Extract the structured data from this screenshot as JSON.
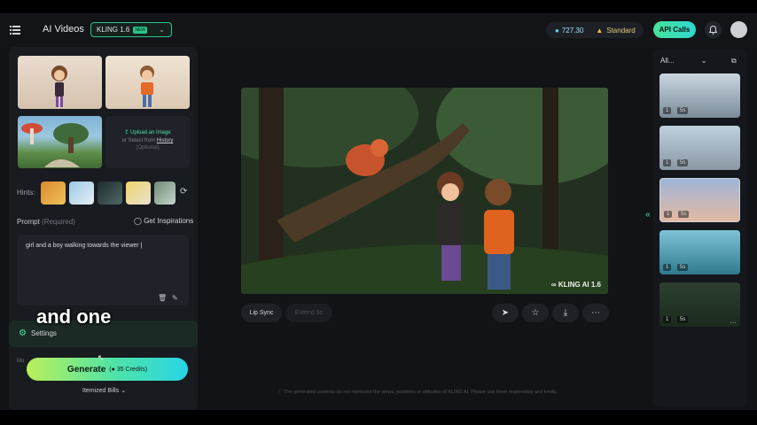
{
  "header": {
    "title": "AI Videos",
    "model": "KLING 1.6",
    "model_badge": "NEW",
    "credits": "727.30",
    "plan": "Standard",
    "api_label": "API Calls"
  },
  "left": {
    "upload_label": "Upload an Image",
    "upload_or": "or Select from",
    "upload_history": "History",
    "upload_optional": "(Optional)",
    "hints_label": "Hints:",
    "prompt_label": "Prompt",
    "prompt_required": "(Required)",
    "inspirations_label": "Get Inspirations",
    "prompt_value": "girl and a boy walking towards the viewer |",
    "settings_label": "Settings",
    "mode_fragment": "Mo",
    "generate_label": "Generate",
    "generate_credits": "35 Credits",
    "itemized_label": "Itemized Bills"
  },
  "caption": "and one",
  "player": {
    "watermark": "KLING AI 1.6",
    "lip_sync": "Lip Sync",
    "extend": "Extend 5s"
  },
  "right": {
    "filter": "All...",
    "items": [
      {
        "count": "1",
        "duration": "5s"
      },
      {
        "count": "1",
        "duration": "5s"
      },
      {
        "count": "1",
        "duration": "5s"
      },
      {
        "count": "1",
        "duration": "5s"
      },
      {
        "count": "1",
        "duration": "5s"
      }
    ]
  },
  "footer": {
    "disclaimer": "The generated contents do not represent the views, positions or attitudes of KLING AI. Please use them responsibly and kindly."
  },
  "colors": {
    "accent_green": "#4fe3a7",
    "accent_cyan": "#27d5e6",
    "background": "#111316"
  }
}
